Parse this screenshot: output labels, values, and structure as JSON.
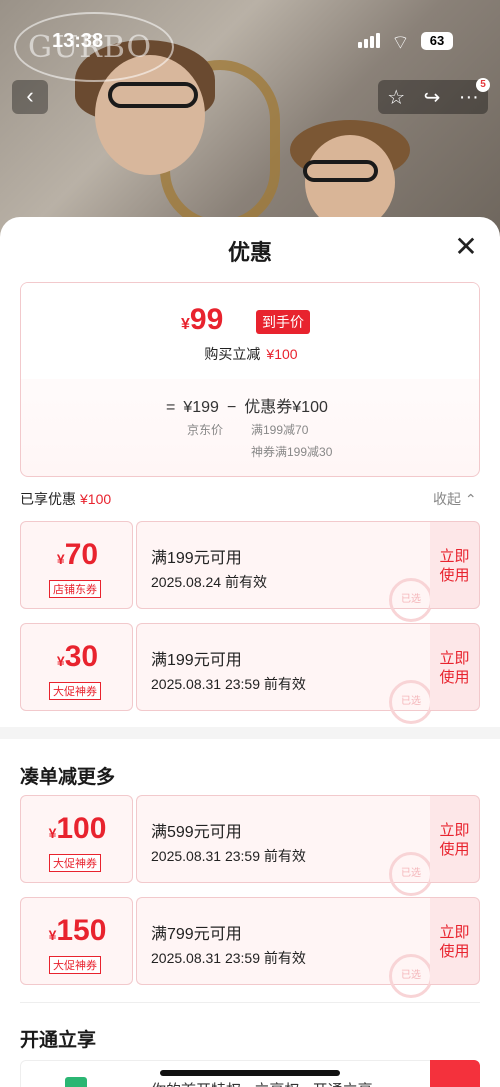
{
  "status": {
    "time": "13:38",
    "battery": "63"
  },
  "watermark": "GURBO",
  "nav": {
    "back": "‹",
    "star": "☆",
    "share": "↪",
    "more": "···",
    "badge": "5"
  },
  "sheet": {
    "title": "优惠",
    "close": "✕"
  },
  "summary": {
    "currency": "¥",
    "final_price": "99",
    "final_tag": "到手价",
    "reduce_label": "购买立减",
    "reduce_amount": "¥100",
    "eq": "=",
    "list_price": "¥199",
    "minus": "−",
    "coupon_total": "优惠券¥100",
    "list_label": "京东价",
    "coupon_line1": "满199减70",
    "coupon_line2": "神券满199减30"
  },
  "enjoyed": {
    "label": "已享优惠",
    "amount": "¥100",
    "collapse": "收起 ⌃"
  },
  "coupons": [
    {
      "currency": "¥",
      "amount": "70",
      "tag": "店铺东券",
      "condition": "满199元可用",
      "date": "2025.08.24 前有效",
      "stamp": "已选",
      "button": "立即使用"
    },
    {
      "currency": "¥",
      "amount": "30",
      "tag": "大促神券",
      "condition": "满199元可用",
      "date": "2025.08.31 23:59 前有效",
      "stamp": "已选",
      "button": "立即使用"
    }
  ],
  "more": {
    "title": "凑单减更多",
    "coupons": [
      {
        "currency": "¥",
        "amount": "100",
        "tag": "大促神券",
        "condition": "满599元可用",
        "date": "2025.08.31 23:59 前有效",
        "stamp": "已选",
        "button": "立即使用"
      },
      {
        "currency": "¥",
        "amount": "150",
        "tag": "大促神券",
        "condition": "满799元可用",
        "date": "2025.08.31 23:59 前有效",
        "stamp": "已选",
        "button": "立即使用"
      }
    ]
  },
  "open": {
    "title": "开通立享",
    "text": "你的首开特权 · 立享权 · 开通立享"
  }
}
